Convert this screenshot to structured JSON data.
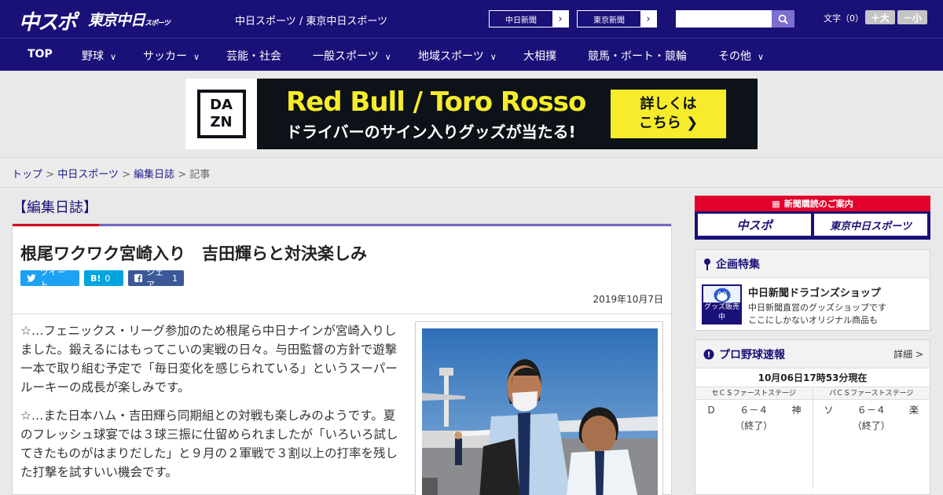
{
  "header": {
    "logo_main": "中スポ",
    "logo_tokyo": "東京中日",
    "logo_tokyo_small": "スポーツ",
    "site_link_1": "中日スポーツ",
    "site_sep": " / ",
    "site_link_2": "東京中日スポーツ",
    "newspaper_btn_1": "中日新聞",
    "newspaper_btn_2": "東京新聞",
    "search_placeholder": "",
    "font_size_label": "文字（0）",
    "font_larger": "＋大",
    "font_smaller": "－小"
  },
  "nav": {
    "items": [
      {
        "label": "TOP",
        "dropdown": false
      },
      {
        "label": "野球",
        "dropdown": true
      },
      {
        "label": "サッカー",
        "dropdown": true
      },
      {
        "label": "芸能・社会",
        "dropdown": false
      },
      {
        "label": "一般スポーツ",
        "dropdown": true
      },
      {
        "label": "地域スポーツ",
        "dropdown": true
      },
      {
        "label": "大相撲",
        "dropdown": false
      },
      {
        "label": "競馬・ボート・競輪",
        "dropdown": false
      },
      {
        "label": "その他",
        "dropdown": true
      }
    ]
  },
  "ad": {
    "brand_line1": "DA",
    "brand_line2": "ZN",
    "headline": "Red Bull / Toro Rosso",
    "subline": "ドライバーのサイン入りグッズが当たる!",
    "cta_line1": "詳しくは",
    "cta_line2": "こちら ❯"
  },
  "breadcrumb": {
    "items": [
      "トップ",
      "中日スポーツ",
      "編集日誌"
    ],
    "current": "記事",
    "sep": " > "
  },
  "article": {
    "section": "【編集日誌】",
    "title": "根尾ワクワク宮崎入り　吉田輝らと対決楽しみ",
    "tweet_label": "ツイート",
    "hatena_label": "B!",
    "hatena_count": "0",
    "fb_label": "シェア",
    "fb_count": "1",
    "date": "2019年10月7日",
    "paragraphs": [
      "☆…フェニックス・リーグ参加のため根尾ら中日ナインが宮崎入りしました。鍛えるにはもってこいの実戦の日々。与田監督の方針で遊撃一本で取り組む予定で「毎日変化を感じられている」というスーパールーキーの成長が楽しみです。",
      "☆…また日本ハム・吉田輝ら同期組との対戦も楽しみのようです。夏のフレッシュ球宴では３球三振に仕留められましたが「いろいろ試してきたものがはまりだした」と９月の２軍戦で３割以上の打率を残した打撃を試すいい機会です。"
    ]
  },
  "sidebar": {
    "subscribe_label": "新聞購読のご案内",
    "sub_logo_1": "中スポ",
    "sub_logo_2": "東京中日スポーツ",
    "feature_title": "企画特集",
    "shop_thumb_label": "グッズ販売中",
    "shop_title": "中日新聞ドラゴンズショップ",
    "shop_desc_1": "中日新聞直営のグッズショップです",
    "shop_desc_2": "ここにしかないオリジナル商品も",
    "scores_title": "プロ野球速報",
    "scores_more": "詳細 >",
    "scores_time": "10月06日17時53分現在",
    "games": [
      {
        "stage": "セＣＳファーストステージ",
        "home": "Ｄ",
        "score": "６－４",
        "away": "神",
        "status": "（終了）"
      },
      {
        "stage": "パＣＳファーストステージ",
        "home": "ソ",
        "score": "６－４",
        "away": "楽",
        "status": "（終了）"
      }
    ]
  },
  "colors": {
    "brand_navy": "#1a1178",
    "accent_red": "#e3002c",
    "twitter": "#1da1f2",
    "hatena": "#00a4de",
    "facebook": "#3b5998",
    "dazn_yellow": "#f6ec2b"
  }
}
